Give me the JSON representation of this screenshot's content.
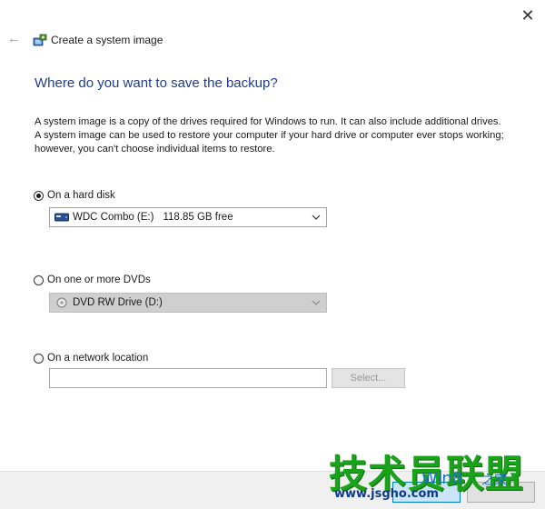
{
  "window": {
    "title": "Create a system image",
    "close_glyph": "✕",
    "back_glyph": "←"
  },
  "heading": "Where do you want to save the backup?",
  "description": "A system image is a copy of the drives required for Windows to run. It can also include additional drives. A system image can be used to restore your computer if your hard drive or computer ever stops working; however, you can't choose individual items to restore.",
  "options": {
    "hard_disk": {
      "label": "On a hard disk",
      "checked": true,
      "drive_name": "WDC Combo (E:)",
      "free_space": "118.85 GB free"
    },
    "dvd": {
      "label": "On one or more DVDs",
      "checked": false,
      "drive_name": "DVD RW Drive (D:)"
    },
    "network": {
      "label": "On a network location",
      "checked": false,
      "path_value": "",
      "select_label": "Select..."
    }
  },
  "watermark": {
    "main": "技术员联盟",
    "site": "www.jsgho.com",
    "win": "Win8",
    "zhijia": "之家"
  },
  "colors": {
    "heading": "#1f3c88",
    "watermark_green": "#19a21a",
    "watermark_blue": "#0b3a8c",
    "disabled_bg": "#cfcfcf"
  }
}
